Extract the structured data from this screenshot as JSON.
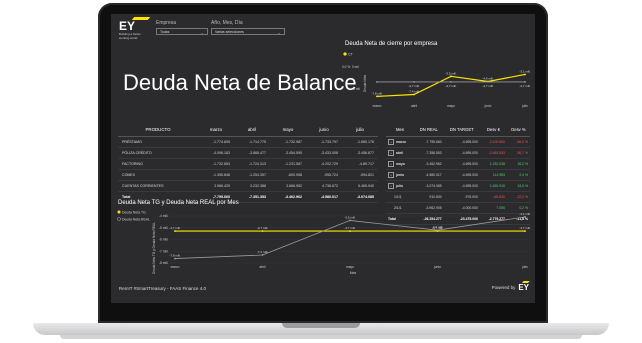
{
  "brand": {
    "logo": "EY",
    "tagline": [
      "Building a better",
      "working world"
    ],
    "accent": "#ffe600"
  },
  "slicers": [
    {
      "label": "Empresa",
      "value": "Todas"
    },
    {
      "label": "Año, Mes, Día",
      "value": "Varias selecciones"
    }
  ],
  "title": "Deuda Neta de Balance",
  "chart_top": {
    "title": "Deuda Neta de cierre por empresa",
    "legend": "CT",
    "ylabel": "Deuda Neta",
    "yticks": [
      "0 mil",
      "-5 mil"
    ],
    "topline": "0.0 %"
  },
  "table1": {
    "headers": [
      "PRODUCTO",
      "marzo",
      "abril",
      "mayo",
      "junio",
      "julio"
    ],
    "rows": [
      [
        "PRÉSTAMO",
        "-1.774.695",
        "-1.714.775",
        "-1.732.987",
        "-1.733.797",
        "-1.680.176"
      ],
      [
        "PÓLIZA CRÉDITO",
        "-4.096.183",
        "-3.865.477",
        "-3.454.595",
        "-3.433.008",
        "-3.456.877"
      ],
      [
        "FACTORING",
        "-1.732.853",
        "-1.724.313",
        "-1.231.587",
        "-4.202.729",
        "-4.89.717"
      ],
      [
        "COMEX",
        "-1.355.848",
        "-1.254.357",
        "-600.958",
        "-955.724",
        "-994.821"
      ],
      [
        "CUENTAS CORRIENTES",
        "3.966.425",
        "3.232.388",
        "3.666.952",
        "4.738.672",
        "5.465.940"
      ]
    ],
    "total": [
      "Total",
      "-7.795.660",
      "-7.351.353",
      "-3.462.962",
      "-4.580.017",
      "-3.074.085"
    ]
  },
  "table2": {
    "headers": [
      "Mes",
      "DN REAL",
      "DN TARGET",
      "Desv €",
      "Desv %"
    ],
    "rows": [
      {
        "mes": "marzo",
        "exp": true,
        "real": "-7.795.660",
        "target": "-4.695.000",
        "desv": "-3.100.660",
        "pct": "-66,0 %",
        "status": "neg"
      },
      {
        "mes": "abril",
        "exp": true,
        "real": "-7.358.553",
        "target": "-4.695.000",
        "desv": "-2.663.553",
        "pct": "-56,7 %",
        "status": "neg"
      },
      {
        "mes": "mayo",
        "exp": true,
        "real": "-3.462.962",
        "target": "-4.695.000",
        "desv": "1.232.038",
        "pct": "26,2 %",
        "status": "pos"
      },
      {
        "mes": "junio",
        "exp": true,
        "real": "-4.580.017",
        "target": "-4.695.000",
        "desv": "114.983",
        "pct": "2,4 %",
        "status": "pos"
      },
      {
        "mes": "julio",
        "exp": true,
        "real": "-3.074.085",
        "target": "-4.695.000",
        "desv": "1.620.915",
        "pct": "34,5 %",
        "status": "pos"
      },
      {
        "mes": "1/1/1",
        "exp": false,
        "real": "910.830",
        "target": "-975.000",
        "desv": "-65.830",
        "pct": "-22,2 %",
        "status": "neg"
      },
      {
        "mes": "2/1/1",
        "exp": false,
        "real": "-3.962.905",
        "target": "-4.000.000",
        "desv": "7.095",
        "pct": "0,2 %",
        "status": "pos"
      }
    ],
    "total": {
      "mes": "Total",
      "real": "-26.254.277",
      "target": "-23.475.000",
      "desv": "-2.779.277",
      "pct": "-11,8 %",
      "status": "neg"
    }
  },
  "chart_data": [
    {
      "type": "line",
      "title": "Deuda Neta de cierre por empresa",
      "categories": [
        "marzo",
        "abril",
        "mayo",
        "junio",
        "julio"
      ],
      "ylabel": "Deuda Neta",
      "series": [
        {
          "name": "CT",
          "values": [
            -7.8,
            -7.4,
            -3.5,
            -4.6,
            -3.1
          ],
          "labels": [
            "-7,8 mill.",
            "-7,4 mill.",
            "-3,5 mill.",
            "-4,6 mill.",
            "-3,1 mill."
          ],
          "color": "#ffe600"
        },
        {
          "values": [
            -4.7,
            -4.7,
            -4.7,
            -4.7,
            -4.7
          ],
          "labels": [
            "",
            "-4,7 mill.",
            "-4,7 mill.",
            "-4,7 mill.",
            "-4,7 mill."
          ],
          "color": "#9a9a9a"
        }
      ],
      "ylim": [
        -9,
        0
      ]
    },
    {
      "type": "line",
      "title": "Deuda Neta TG y Deuda Neta REAL por Mes",
      "categories": [
        "marzo",
        "abril",
        "mayo",
        "junio",
        "julio"
      ],
      "xlabel": "Mes",
      "ylabel": "Deuda Neta TG y Deuda Neta REAL",
      "yticks": [
        "-4 mill.",
        "-5 mill.",
        "-6 mill.",
        "-7 mill.",
        "-8 mill."
      ],
      "series": [
        {
          "name": "Deuda Neta TG",
          "values": [
            -4.7,
            -4.7,
            -4.7,
            -4.7,
            -4.7
          ],
          "labels": [
            "-4,7 mill.",
            "-4,7 mill.",
            "-4,7 mill.",
            "-4,7 mill.",
            "-4,7 mill."
          ],
          "color": "#ffe600"
        },
        {
          "name": "Deuda Neta REAL",
          "values": [
            -7.8,
            -7.4,
            -3.5,
            -4.6,
            -3.1
          ],
          "labels": [
            "-7,8 mill.",
            "-7,4 mill.",
            "-3,5 mill.",
            "-4,6 mill.",
            "-3,1 mill."
          ],
          "color": "#9a9a9a"
        }
      ],
      "ylim": [
        -8.3,
        -3.0
      ]
    }
  ],
  "footer": {
    "left": "RemIT #SmartTreasury - FAAS Finance 4.0",
    "right": "Powered by",
    "logo": "EY"
  }
}
